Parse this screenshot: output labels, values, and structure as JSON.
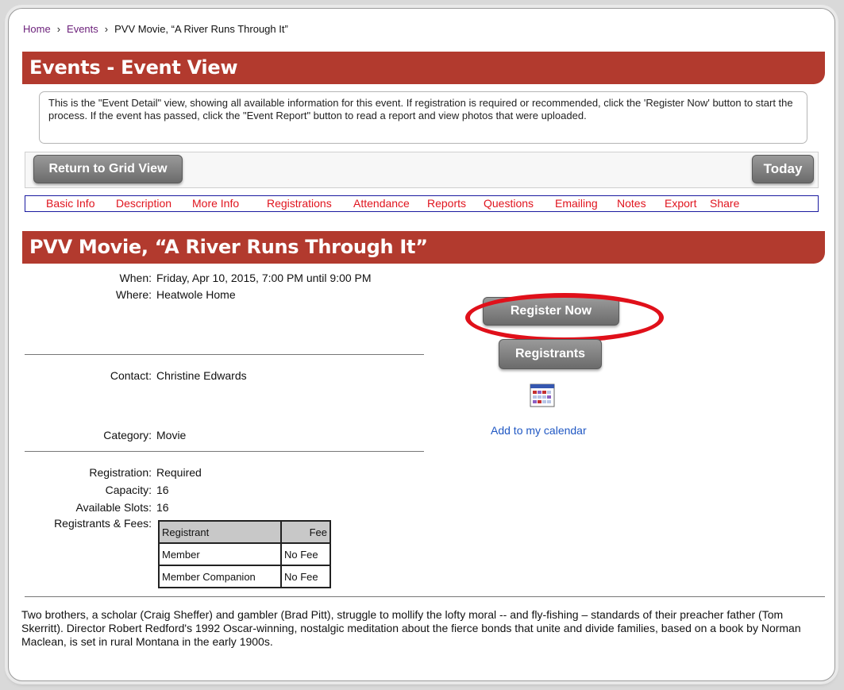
{
  "breadcrumb": {
    "home": "Home",
    "sep": "›",
    "events": "Events",
    "current": "PVV Movie, “A River Runs Through It”"
  },
  "page_banner": "Events - Event View",
  "intro_text": "This is the \"Event Detail\" view, showing all available information for this event. If registration is required or recommended, click the 'Register Now' button to start the process. If the event has passed, click the \"Event Report\" button to read a report and view photos that were uploaded.",
  "toolbar": {
    "return_label": "Return to Grid View",
    "today_label": "Today"
  },
  "tabs": [
    "Basic Info",
    "Description",
    "More Info",
    "Registrations",
    "Attendance",
    "Reports",
    "Questions",
    "Emailing",
    "Notes",
    "Export",
    "Share"
  ],
  "event": {
    "title": "PVV Movie, “A River Runs Through It”",
    "when_label": "When:",
    "when": "Friday, Apr 10, 2015, 7:00 PM until 9:00 PM",
    "where_label": "Where:",
    "where": "Heatwole Home",
    "contact_label": "Contact:",
    "contact": "Christine Edwards",
    "category_label": "Category:",
    "category": "Movie",
    "registration_label": "Registration:",
    "registration": "Required",
    "capacity_label": "Capacity:",
    "capacity": "16",
    "slots_label": "Available Slots:",
    "slots": "16",
    "fees_label": "Registrants & Fees:"
  },
  "fees_table": {
    "headers": [
      "Registrant",
      "Fee"
    ],
    "rows": [
      [
        "Member",
        "No Fee"
      ],
      [
        "Member Companion",
        "No Fee"
      ]
    ]
  },
  "actions": {
    "register_label": "Register Now",
    "registrants_label": "Registrants",
    "calendar_label": "Add to my calendar"
  },
  "description": "Two brothers, a scholar (Craig Sheffer) and gambler (Brad Pitt), struggle to mollify the lofty moral -- and fly-fishing – standards of their preacher father (Tom Skerritt). Director Robert Redford's 1992 Oscar-winning, nostalgic meditation about the fierce bonds that unite and divide families, based on a book by Norman Maclean, is set in rural Montana in the early 1900s.",
  "colors": {
    "banner": "#b23a2e",
    "tab_text": "#e0141e",
    "tab_border": "#1a1aa0",
    "highlight_ring": "#e0101a",
    "link": "#1f57c3"
  }
}
